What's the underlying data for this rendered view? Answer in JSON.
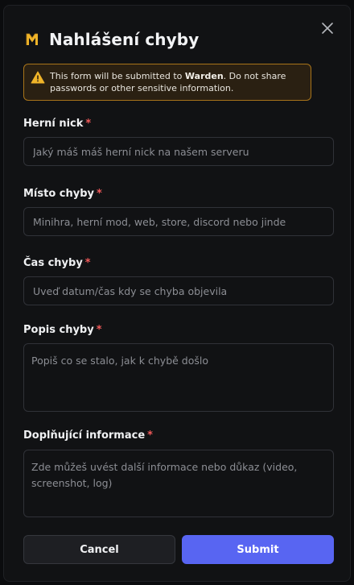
{
  "dialog": {
    "title": "Nahlášení chyby",
    "warning": {
      "prefix": "This form will be submitted to ",
      "recipient": "Warden",
      "suffix": ". Do not share passwords or other sensitive information."
    },
    "fields": [
      {
        "label": "Herní nick",
        "required": "*",
        "placeholder": "Jaký máš máš herní nick na našem serveru",
        "value": ""
      },
      {
        "label": "Místo chyby",
        "required": "*",
        "placeholder": "Minihra, herní mod, web, store, discord nebo jinde",
        "value": ""
      },
      {
        "label": "Čas chyby",
        "required": "*",
        "placeholder": "Uveď datum/čas kdy se chyba objevila",
        "value": ""
      },
      {
        "label": "Popis chyby",
        "required": "*",
        "placeholder": "Popiš co se stalo, jak k chybě došlo",
        "value": ""
      },
      {
        "label": "Doplňující informace",
        "required": "*",
        "placeholder": "Zde můžeš uvést další informace nebo důkaz (video, screenshot, log)",
        "value": ""
      }
    ],
    "buttons": {
      "cancel": "Cancel",
      "submit": "Submit"
    },
    "icons": {
      "logo": "brand-logo-icon",
      "close": "close-icon",
      "warning": "warning-icon"
    }
  },
  "colors": {
    "background": "#111214",
    "warning_border": "#a8741a",
    "warning_background": "#2a2012",
    "required_marker": "#f25a5a",
    "submit": "#5865f2",
    "logo": "#f0b429"
  }
}
